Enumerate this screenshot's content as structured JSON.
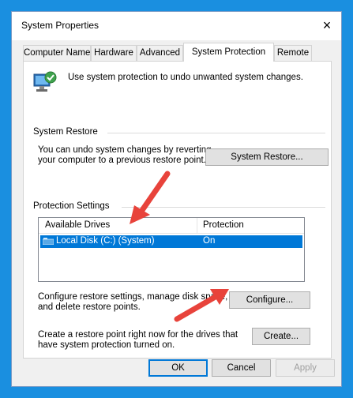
{
  "window": {
    "title": "System Properties",
    "close_icon": "×"
  },
  "tabs": [
    {
      "label": "Computer Name"
    },
    {
      "label": "Hardware"
    },
    {
      "label": "Advanced"
    },
    {
      "label": "System Protection"
    },
    {
      "label": "Remote"
    }
  ],
  "active_tab": "System Protection",
  "intro": {
    "text": "Use system protection to undo unwanted system changes."
  },
  "system_restore": {
    "group_title": "System Restore",
    "text_line1": "You can undo system changes by reverting",
    "text_line2": "your computer to a previous restore point.",
    "button_label": "System Restore..."
  },
  "protection": {
    "group_title": "Protection Settings",
    "columns": [
      "Available Drives",
      "Protection"
    ],
    "drives": [
      {
        "name": "Local Disk (C:) (System)",
        "protection": "On"
      }
    ],
    "configure_text_line1": "Configure restore settings, manage disk space,",
    "configure_text_line2": "and delete restore points.",
    "configure_label": "Configure...",
    "create_text_line1": "Create a restore point right now for the drives that",
    "create_text_line2": "have system protection turned on.",
    "create_label": "Create..."
  },
  "footer": {
    "ok_label": "OK",
    "cancel_label": "Cancel",
    "apply_label": "Apply"
  },
  "colors": {
    "accent": "#0078d7",
    "arrow": "#e8433b",
    "desktop": "#1a8fe0"
  }
}
